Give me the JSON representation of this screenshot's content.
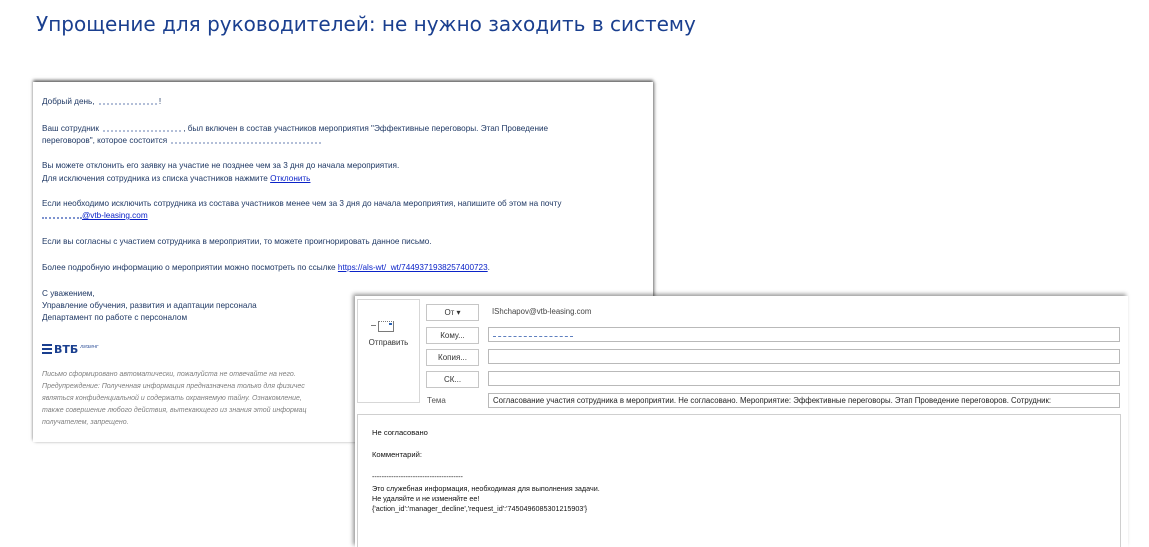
{
  "page_title": "Упрощение для руководителей: не нужно заходить в систему",
  "email": {
    "greeting_prefix": "Добрый день,",
    "greeting_suffix": "!",
    "para1_prefix": "Ваш сотрудник",
    "para1_rest": ", был включен в состав участников мероприятия \"Эффективные переговоры. Этап Проведение",
    "para1_line2": "переговоров\", которое состоится",
    "para2_line1": "Вы можете отклонить его заявку на участие не позднее чем за 3 дня до начала мероприятия.",
    "para2_line2_prefix": "Для исключения сотрудника из списка участников нажмите",
    "decline_link": "Отклонить",
    "para3_line1": "Если необходимо исключить сотрудника из состава участников менее чем за 3 дня до начала мероприятия, напишите об этом на почту",
    "mail_suffix": "@vtb-leasing.com",
    "para4": "Если вы согласны с участием сотрудника в мероприятии, то можете проигнорировать данное письмо.",
    "para5_prefix": "Более подробную информацию о мероприятии можно посмотреть по ссылке",
    "event_link": "https://als-wt/_wt/7449371938257400723",
    "para5_suffix": ".",
    "signoff": "С уважением,",
    "sig_dept1": "Управление обучения, развития и адаптации персонала",
    "sig_dept2": "Департамент по работе с персоналом",
    "logo_text": "ВТБ",
    "logo_sub": "ЛИЗИНГ",
    "disclaimer": [
      "Письмо сформировано автоматически, пожалуйста не отвечайте на него.",
      "Предупреждение: Полученная информация предназначена только для физичес",
      "являться конфиденциальной и содержать охраняемую тайну. Ознакомление,",
      "также совершение любого действия, вытекающего из знания этой информац",
      "получателем, запрещено."
    ]
  },
  "compose": {
    "send_label": "Отправить",
    "from_button": "От ▾",
    "from_value": "IShchapov@vtb-leasing.com",
    "to_button": "Кому...",
    "cc_button": "Копия...",
    "bcc_button": "СК...",
    "subject_label": "Тема",
    "subject_value": "Согласование участия сотрудника в мероприятии. Не согласовано. Мероприятие: Эффективные переговоры. Этап Проведение переговоров. Сотрудник:",
    "body": {
      "status": "Не согласовано",
      "comment_label": "Комментарий:",
      "separator": "--------------------------------------",
      "service_info": "Это служебная информация, необходимая для выполнения задачи.",
      "do_not_edit": "Не удаляйте и не изменяйте ее!",
      "payload": "{'action_id':'manager_decline','request_id':'7450496085301215903'}"
    }
  }
}
